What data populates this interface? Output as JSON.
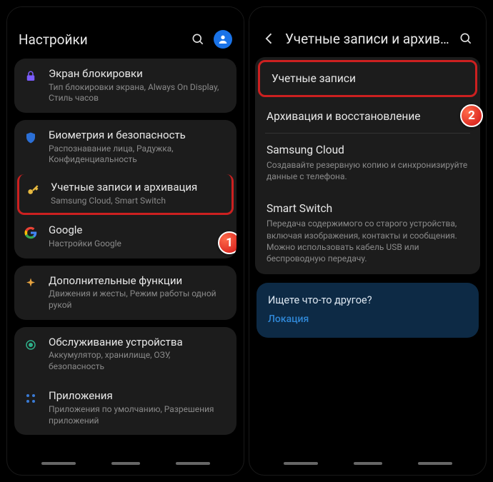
{
  "left": {
    "header": {
      "title": "Настройки"
    },
    "groups": [
      {
        "items": [
          {
            "icon": "lock-icon",
            "color": "#7b5cff",
            "title": "Экран блокировки",
            "subtitle": "Тип блокировки экрана, Always On Display, Стиль часов"
          }
        ]
      },
      {
        "items": [
          {
            "icon": "shield-icon",
            "color": "#2b6fd6",
            "title": "Биометрия и безопасность",
            "subtitle": "Распознавание лица, Радужка, Конфиденциальность"
          },
          {
            "icon": "key-icon",
            "color": "#e7b93f",
            "title": "Учетные записи и архивация",
            "subtitle": "Samsung Cloud, Smart Switch",
            "highlight": true
          },
          {
            "icon": "google-icon",
            "color": "#2b6fd6",
            "title": "Google",
            "subtitle": "Настройки Google"
          }
        ]
      },
      {
        "items": [
          {
            "icon": "sparkle-icon",
            "color": "#e7a33f",
            "title": "Дополнительные функции",
            "subtitle": "Движения и жесты, Режим работы одной рукой"
          }
        ]
      },
      {
        "items": [
          {
            "icon": "care-icon",
            "color": "#2fb08a",
            "title": "Обслуживание устройства",
            "subtitle": "Аккумулятор, хранилище, ОЗУ, безопасность"
          },
          {
            "icon": "apps-icon",
            "color": "#3a7bd6",
            "title": "Приложения",
            "subtitle": "Приложения по умолчанию, Разрешения приложений"
          }
        ]
      }
    ],
    "badge1": "1"
  },
  "right": {
    "header": {
      "title": "Учетные записи и архивац…"
    },
    "items": [
      {
        "title": "Учетные записи",
        "highlight": true
      },
      {
        "title": "Архивация и восстановление"
      },
      {
        "title": "Samsung Cloud",
        "subtitle": "Создавайте резервную копию и синхронизируйте данные с телефона."
      },
      {
        "title": "Smart Switch",
        "subtitle": "Передача содержимого со старого устройства, включая изображения, контакты и сообщения. Можно использовать кабель USB или беспроводную передачу."
      }
    ],
    "promo": {
      "question": "Ищете что-то другое?",
      "link": "Локация"
    },
    "badge2": "2"
  }
}
